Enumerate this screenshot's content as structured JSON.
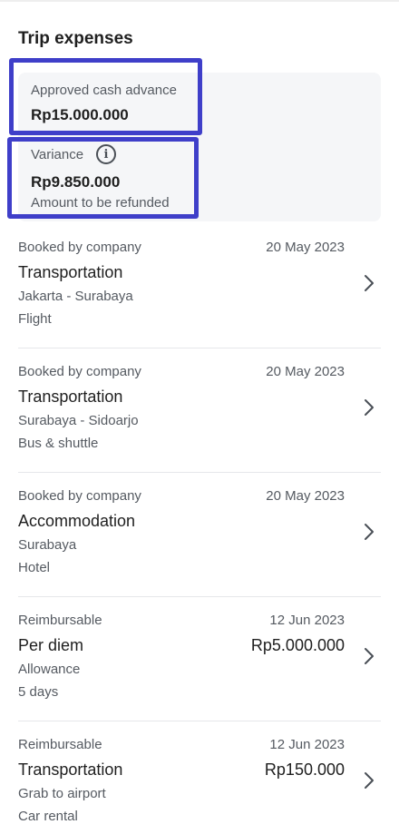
{
  "header": {
    "title": "Trip expenses"
  },
  "summary": {
    "advance_label": "Approved cash advance",
    "advance_amount": "Rp15.000.000",
    "variance_label": "Variance",
    "variance_amount": "Rp9.850.000",
    "variance_note": "Amount to be refunded",
    "info_icon": "info-icon"
  },
  "colors": {
    "highlight": "#3f3fc9",
    "summary_bg": "#f5f6f8",
    "text_primary": "#1f1f1f",
    "text_secondary": "#555a61",
    "divider": "#e6e7ea"
  },
  "expenses": [
    {
      "type": "Booked by company",
      "date": "20 May 2023",
      "category": "Transportation",
      "amount": "",
      "detail1": "Jakarta - Surabaya",
      "detail2": "Flight"
    },
    {
      "type": "Booked by company",
      "date": "20 May 2023",
      "category": "Transportation",
      "amount": "",
      "detail1": "Surabaya - Sidoarjo",
      "detail2": "Bus & shuttle"
    },
    {
      "type": "Booked by company",
      "date": "20 May 2023",
      "category": "Accommodation",
      "amount": "",
      "detail1": "Surabaya",
      "detail2": "Hotel"
    },
    {
      "type": "Reimbursable",
      "date": "12 Jun 2023",
      "category": "Per diem",
      "amount": "Rp5.000.000",
      "detail1": "Allowance",
      "detail2": "5 days"
    },
    {
      "type": "Reimbursable",
      "date": "12 Jun 2023",
      "category": "Transportation",
      "amount": "Rp150.000",
      "detail1": "Grab to airport",
      "detail2": "Car rental"
    }
  ]
}
